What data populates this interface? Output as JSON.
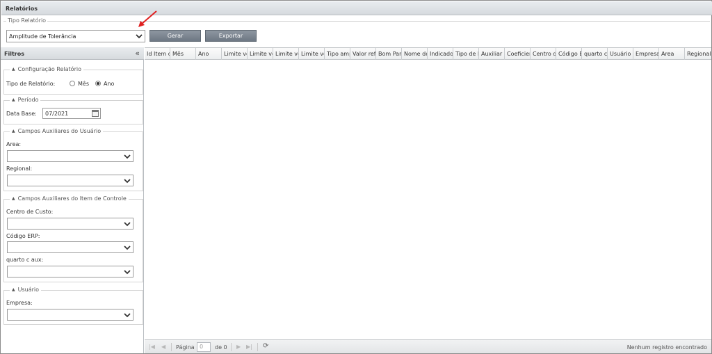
{
  "window": {
    "title": "Relatórios"
  },
  "report_type": {
    "legend": "Tipo Relatório",
    "selected": "Amplitude de Tolerância"
  },
  "toolbar": {
    "generate_label": "Gerar",
    "export_label": "Exportar"
  },
  "filters": {
    "header": "Filtros",
    "collapse_symbol": "«",
    "config": {
      "legend": "Configuração Relatório",
      "type_label": "Tipo de Relatório:",
      "option_month": "Mês",
      "option_year": "Ano",
      "selected": "Ano"
    },
    "period": {
      "legend": "Período",
      "date_label": "Data Base:",
      "date_value": "07/2021"
    },
    "user_aux": {
      "legend": "Campos Auxiliares do Usuário",
      "area_label": "Area:",
      "area_value": "",
      "regional_label": "Regional:",
      "regional_value": ""
    },
    "item_aux": {
      "legend": "Campos Auxiliares do Item de Controle",
      "cost_center_label": "Centro de Custo:",
      "cost_center_value": "",
      "erp_label": "Código ERP:",
      "erp_value": "",
      "quarto_label": "quarto c aux:",
      "quarto_value": ""
    },
    "user": {
      "legend": "Usuário",
      "company_label": "Empresa:",
      "company_value": ""
    }
  },
  "grid": {
    "columns": [
      "Id Item d",
      "Mês",
      "Ano",
      "Limite ve",
      "Limite ve",
      "Limite ve",
      "Limite ve",
      "Tipo amp",
      "Valor refe",
      "Bom Para",
      "Nome do",
      "Indicador",
      "Tipo de I",
      "Auxiliar",
      "Coeficien",
      "Centro de",
      "Código E",
      "quarto c",
      "Usuário",
      "Empresa",
      "Area",
      "Regional"
    ]
  },
  "pager": {
    "page_label": "Página",
    "page_value": "0",
    "of_label": "de 0",
    "status": "Nenhum registro encontrado"
  },
  "colors": {
    "button": "#7a838e",
    "annotation_arrow": "#e02020"
  }
}
